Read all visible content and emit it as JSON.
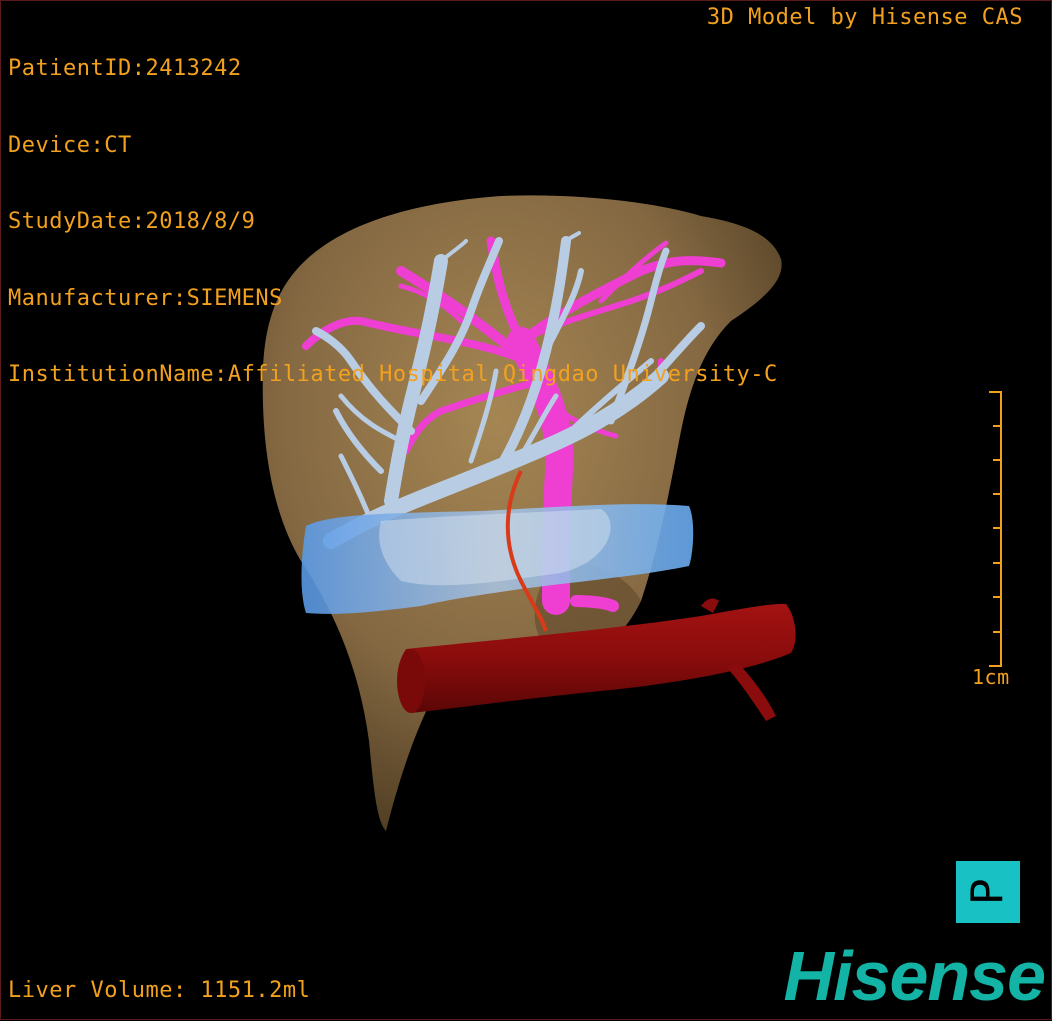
{
  "header": {
    "patient_id": "PatientID:2413242",
    "device": "Device:CT",
    "study_date": "StudyDate:2018/8/9",
    "manufacturer": "Manufacturer:SIEMENS",
    "institution": "InstitutionName:Affiliated Hospital Qingdao University-C"
  },
  "brand_label": "3D Model by Hisense CAS",
  "footer": {
    "liver_volume": "Liver Volume: 1151.2ml"
  },
  "scale_bar": {
    "label": "1cm"
  },
  "orientation_marker": {
    "label": "P"
  },
  "logo": {
    "text": "Hisense"
  },
  "colors": {
    "overlay_text": "#f2a11f",
    "liver": "#8a6d45",
    "hepatic_veins": "#b8cde4",
    "portal_vein": "#ee3fd2",
    "vena_cava": "#8a0c0c",
    "tumor_region": "#6aaef5",
    "logo": "#13b3a5",
    "orientation_box": "#17c1c4"
  }
}
